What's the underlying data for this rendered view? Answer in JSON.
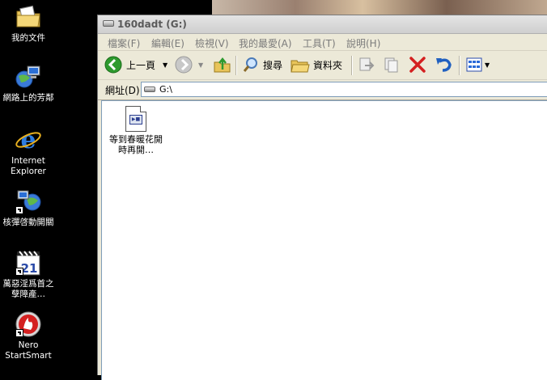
{
  "desktop": {
    "icons": [
      {
        "label": "我的文件",
        "icon": "my-documents-folder-icon"
      },
      {
        "label": "網路上的芳鄰",
        "icon": "network-places-icon"
      },
      {
        "label": "Internet Explorer",
        "icon": "internet-explorer-icon"
      },
      {
        "label": "核彈啓動開關",
        "icon": "network-shortcut-icon"
      },
      {
        "label": "萬惡淫爲首之孽障產…",
        "icon": "media-player-classic-icon"
      },
      {
        "label": "Nero StartSmart",
        "icon": "nero-icon"
      }
    ]
  },
  "window": {
    "title": "160dadt (G:)",
    "menu": [
      "檔案(F)",
      "編輯(E)",
      "檢視(V)",
      "我的最愛(A)",
      "工具(T)",
      "說明(H)"
    ],
    "toolbar": {
      "back_label": "上一頁",
      "search_label": "搜尋",
      "folders_label": "資料夾"
    },
    "address": {
      "label": "網址(D)",
      "value": "G:\\"
    },
    "files": [
      {
        "name": "等到春暖花開時再開…",
        "icon": "video-file-icon"
      }
    ]
  },
  "colors": {
    "window_bg": "#ece9d8",
    "back_arrow": "#2e9a2e",
    "delete_x": "#d42020",
    "undo": "#2060c0"
  }
}
